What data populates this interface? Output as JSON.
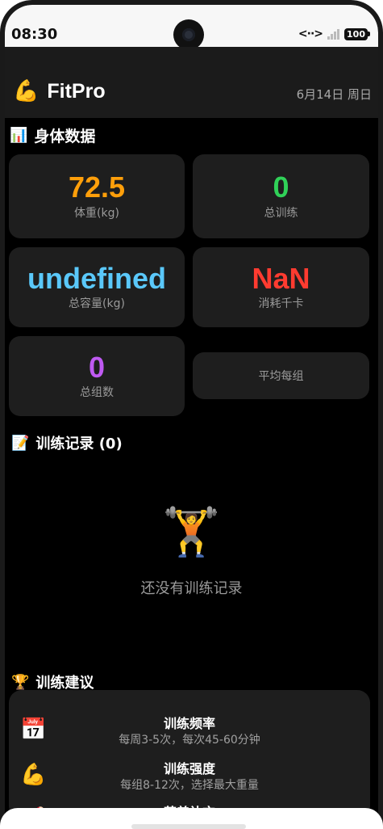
{
  "status_bar": {
    "time": "08:30",
    "network": "<··>",
    "battery": "100"
  },
  "header": {
    "logo_icon": "💪",
    "app_name": "FitPro",
    "date": "6月14日 周日"
  },
  "body_section": {
    "icon": "📊",
    "title": "身体数据",
    "stats": [
      {
        "value": "72.5",
        "label": "体重(kg)",
        "color": "#ff9f0a"
      },
      {
        "value": "0",
        "label": "总训练",
        "color": "#30d158"
      },
      {
        "value": "undefined",
        "label": "总容量(kg)",
        "color": "#5ac8fa"
      },
      {
        "value": "NaN",
        "label": "消耗千卡",
        "color": "#ff3b30"
      },
      {
        "value": "0",
        "label": "总组数",
        "color": "#bf5af2"
      },
      {
        "value": "",
        "label": "平均每组",
        "color": "#ffffff"
      }
    ]
  },
  "records_section": {
    "icon": "📝",
    "title": "训练记录 (0)",
    "empty_icon": "🏋️",
    "empty_text": "还没有训练记录"
  },
  "tips_section": {
    "icon": "🏆",
    "title": "训练建议",
    "items": [
      {
        "icon": "📅",
        "title": "训练频率",
        "desc": "每周3-5次，每次45-60分钟"
      },
      {
        "icon": "💪",
        "title": "训练强度",
        "desc": "每组8-12次，选择最大重量"
      },
      {
        "icon": "🥩",
        "title": "营养补充",
        "desc": ""
      }
    ]
  }
}
